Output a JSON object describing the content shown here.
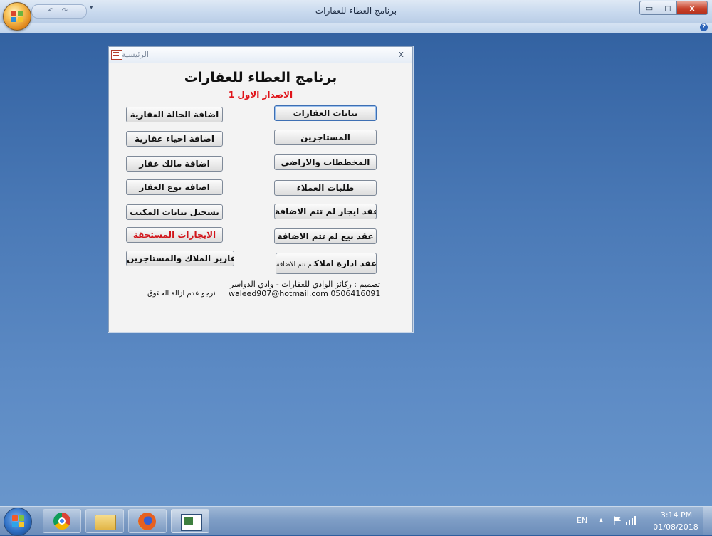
{
  "window": {
    "title": "برنامج العطاء للعقارات",
    "qat_icons": "↶ ↷",
    "qat_menu": "▾",
    "min": "▭",
    "max": "◻",
    "close": "x",
    "help": "?"
  },
  "dialog": {
    "caption": "الرئيسية",
    "close": "x",
    "app_title": "برنامج العطاء للعقارات",
    "version": "الاصدار الاول 1",
    "right_buttons": [
      "بيانات العقارات",
      "المستاجرين",
      "المخططات والاراضي",
      "طلبات العملاء",
      "عقد ايجار  لم تتم الاضافة",
      "عقد بيع لم تتم الاضافة"
    ],
    "mgmt_button": {
      "main": "عقد ادارة املاك",
      "suffix": "لم تتم الاضافة"
    },
    "left_buttons": [
      "اضافة الحالة العقارية",
      "اضافة احياء عقارية",
      "اضافة مالك عقار",
      "اضافة نوع  العقار",
      "تسجيل بيانات المكتب",
      "الايجارات المستحقة",
      "تقارير الملاك والمستاجرين"
    ],
    "credit_design": "تصميم : ركائز الوادي للعقارات - وادي الدواسر",
    "credit_contact": "waleed907@hotmail.com  0506416091",
    "credit_rights": "نرجو عدم ازالة الحقوق"
  },
  "taskbar": {
    "language": "EN",
    "tray_arrow": "▲",
    "time": "3:14 PM",
    "date": "01/08/2018"
  },
  "colors": {
    "accent_red": "#e0141a",
    "desktop_blue": "#4a79b6"
  }
}
